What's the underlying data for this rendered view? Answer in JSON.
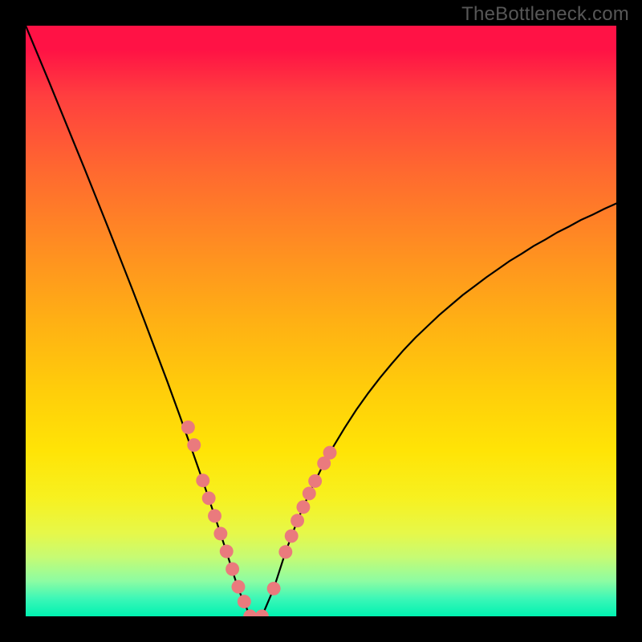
{
  "watermark": "TheBottleneck.com",
  "colors": {
    "frame": "#000000",
    "watermark_text": "#575757",
    "curve_stroke": "#000000",
    "dot_fill": "#ea7a7d",
    "gradient_stops": [
      {
        "pct": 0,
        "hex": "#ff1245"
      },
      {
        "pct": 12,
        "hex": "#ff3f3f"
      },
      {
        "pct": 25,
        "hex": "#ff6a2f"
      },
      {
        "pct": 38,
        "hex": "#ff8f21"
      },
      {
        "pct": 50,
        "hex": "#ffb014"
      },
      {
        "pct": 62,
        "hex": "#ffce0a"
      },
      {
        "pct": 72,
        "hex": "#ffe406"
      },
      {
        "pct": 80,
        "hex": "#f7f120"
      },
      {
        "pct": 86,
        "hex": "#e6f84a"
      },
      {
        "pct": 90,
        "hex": "#c6fb74"
      },
      {
        "pct": 94,
        "hex": "#8dfca2"
      },
      {
        "pct": 97,
        "hex": "#3cf7b7"
      },
      {
        "pct": 100,
        "hex": "#00f2b1"
      }
    ]
  },
  "chart_data": {
    "type": "line",
    "title": "",
    "xlabel": "",
    "ylabel": "",
    "xlim": [
      0,
      100
    ],
    "ylim": [
      0,
      100
    ],
    "x": [
      0,
      2,
      4,
      6,
      8,
      10,
      12,
      14,
      16,
      18,
      20,
      22,
      24,
      26,
      28,
      30,
      32,
      34,
      36,
      38,
      40,
      42,
      44,
      46,
      48,
      50,
      52,
      54,
      56,
      58,
      60,
      62,
      64,
      66,
      68,
      70,
      72,
      74,
      76,
      78,
      80,
      82,
      84,
      86,
      88,
      90,
      92,
      94,
      96,
      98,
      100
    ],
    "series": [
      {
        "name": "curve",
        "values": [
          100,
          95.2,
          90.4,
          85.5,
          80.6,
          75.7,
          70.7,
          65.7,
          60.6,
          55.5,
          50.3,
          45.0,
          39.7,
          34.2,
          28.6,
          22.9,
          17.0,
          10.9,
          4.6,
          0.0,
          0.0,
          4.7,
          10.9,
          16.2,
          20.8,
          24.9,
          28.6,
          31.9,
          35.0,
          37.8,
          40.4,
          42.8,
          45.1,
          47.2,
          49.1,
          51.0,
          52.7,
          54.4,
          55.9,
          57.4,
          58.8,
          60.2,
          61.4,
          62.7,
          63.8,
          65.0,
          66.0,
          67.1,
          68.0,
          69.0,
          69.9
        ]
      },
      {
        "name": "markers",
        "x": [
          27.5,
          28.5,
          30.0,
          31.0,
          32.0,
          33.0,
          34.0,
          35.0,
          36.0,
          37.0,
          38.0,
          40.0,
          42.0,
          44.0,
          45.0,
          46.0,
          47.0,
          48.0,
          49.0,
          50.5,
          51.5
        ],
        "values": [
          32.0,
          29.0,
          23.0,
          20.0,
          17.0,
          14.0,
          11.0,
          8.0,
          5.0,
          2.5,
          0.0,
          0.0,
          4.7,
          10.9,
          13.6,
          16.2,
          18.5,
          20.8,
          22.9,
          25.9,
          27.7
        ]
      }
    ]
  }
}
